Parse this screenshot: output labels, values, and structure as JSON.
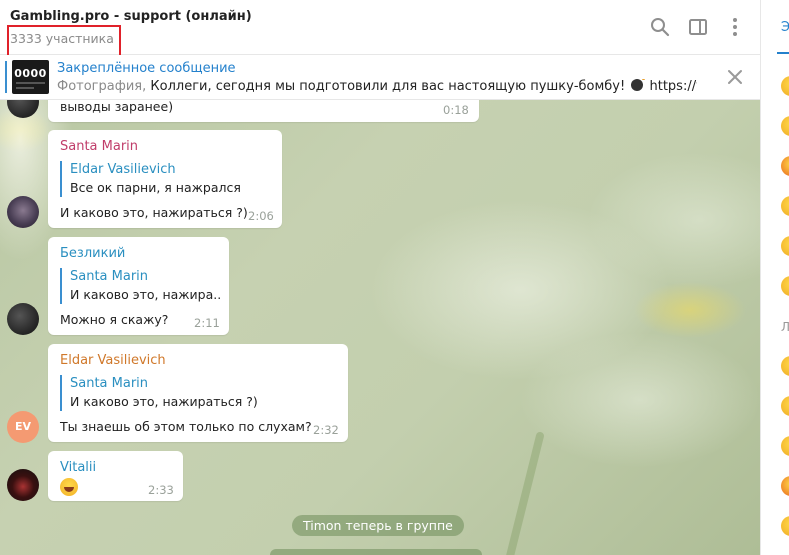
{
  "header": {
    "title": "Gambling.pro - support (онлайн)",
    "subtitle": "3333 участника",
    "icons": [
      "search-icon",
      "sidebar-toggle-icon",
      "more-vertical-icon"
    ]
  },
  "pinned": {
    "title": "Закреплённое сообщение",
    "prefix": "Фотография,",
    "text_before_emoji": "Коллеги, сегодня мы подготовили для вас настоящую пушку-бомбу!",
    "text_after_emoji": "https://vk.com/...",
    "thumb_text": "0000"
  },
  "messages": [
    {
      "text": "выводы заранее)",
      "time": "0:18"
    },
    {
      "sender": "Santa Marin",
      "sender_color": "#c03d6a",
      "reply": {
        "name": "Eldar Vasilievich",
        "text": "Все ок парни, я нажрался"
      },
      "text": "И каково это, нажираться ?)",
      "time": "2:06"
    },
    {
      "sender": "Безликий",
      "sender_color": "#2a8fc0",
      "reply": {
        "name": "Santa Marin",
        "text": "И каково это, нажира..."
      },
      "text": "Можно я скажу?",
      "time": "2:11"
    },
    {
      "sender": "Eldar Vasilievich",
      "sender_color": "#d0782a",
      "avatar_initials": "EV",
      "reply": {
        "name": "Santa Marin",
        "text": "И каково это, нажираться ?)"
      },
      "text": "Ты знаешь об этом только по слухам?",
      "time": "2:32"
    },
    {
      "sender": "Vitalii",
      "sender_color": "#2a8fc0",
      "emoji": "laughing-emoji",
      "time": "2:33"
    }
  ],
  "service_message": "Timon теперь в группе",
  "right_panel": {
    "tab_partial": "Э",
    "section_partial": "Л"
  },
  "colors": {
    "accent": "#2481cc",
    "highlight": "#e0212a",
    "service_bg": "#6e8c5a"
  }
}
